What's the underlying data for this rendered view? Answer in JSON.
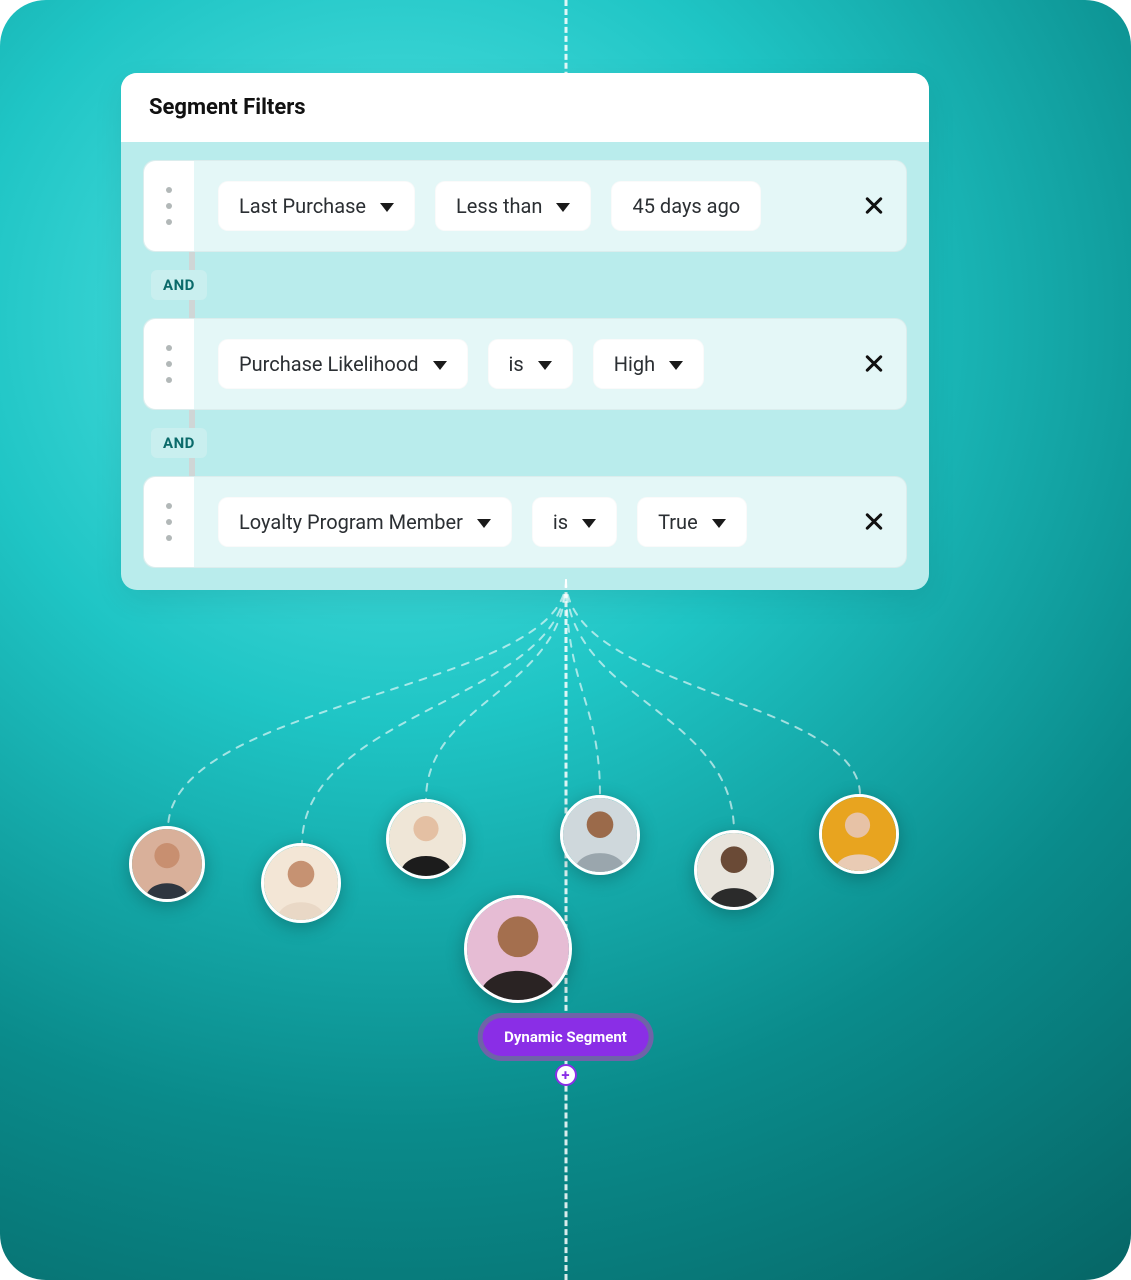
{
  "card": {
    "title": "Segment Filters",
    "operator": "AND",
    "rows": [
      {
        "field": "Last Purchase",
        "op": "Less than",
        "value": "45 days ago"
      },
      {
        "field": "Purchase Likelihood",
        "op": "is",
        "value": "High"
      },
      {
        "field": "Loyalty Program Member",
        "op": "is",
        "value": "True"
      }
    ]
  },
  "segment_badge": "Dynamic Segment",
  "plus": "+",
  "avatars": [
    {
      "bg": "#d9b09a",
      "skin": "#c88f70"
    },
    {
      "bg": "#f3e6d6",
      "skin": "#c69272"
    },
    {
      "bg": "#efe6d7",
      "skin": "#e4c0a3"
    },
    {
      "bg": "#cfd8dc",
      "skin": "#9b6a4a"
    },
    {
      "bg": "#e8e4dc",
      "skin": "#6a4a36"
    },
    {
      "bg": "#e8a41f",
      "skin": "#e7c2a6"
    },
    {
      "bg": "#e6bcd4",
      "skin": "#a46f4e"
    }
  ]
}
